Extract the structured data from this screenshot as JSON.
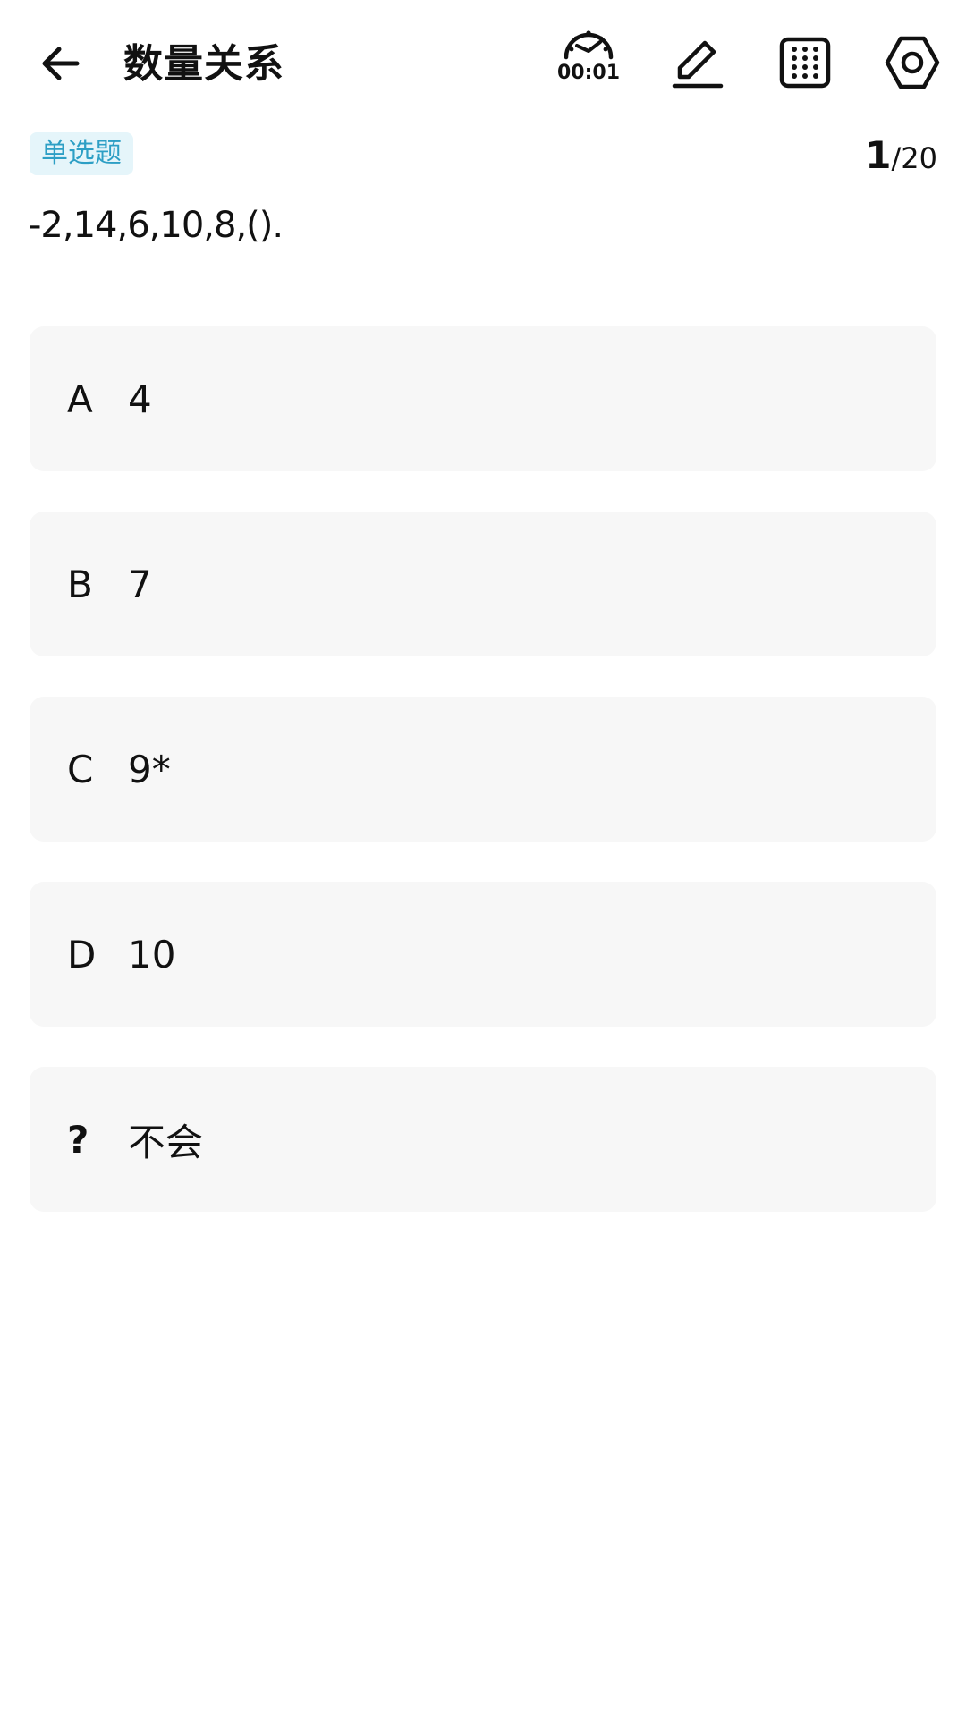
{
  "header": {
    "title": "数量关系",
    "timer": "00:01",
    "icons": {
      "back": "arrow-left-icon",
      "timer": "stopwatch-icon",
      "edit": "pencil-icon",
      "sheet": "answer-grid-icon",
      "settings": "hexagon-gear-icon"
    }
  },
  "question": {
    "type_label": "单选题",
    "current": "1",
    "separator": "/",
    "total": "20",
    "text": "-2,14,6,10,8,()."
  },
  "options": [
    {
      "key": "A",
      "text": "4"
    },
    {
      "key": "B",
      "text": "7"
    },
    {
      "key": "C",
      "text": "9*"
    },
    {
      "key": "D",
      "text": "10"
    },
    {
      "key": "?",
      "text": "不会"
    }
  ],
  "colors": {
    "badge_bg": "#e5f5fa",
    "badge_text": "#2d9fc5",
    "option_bg": "#f7f7f7"
  }
}
